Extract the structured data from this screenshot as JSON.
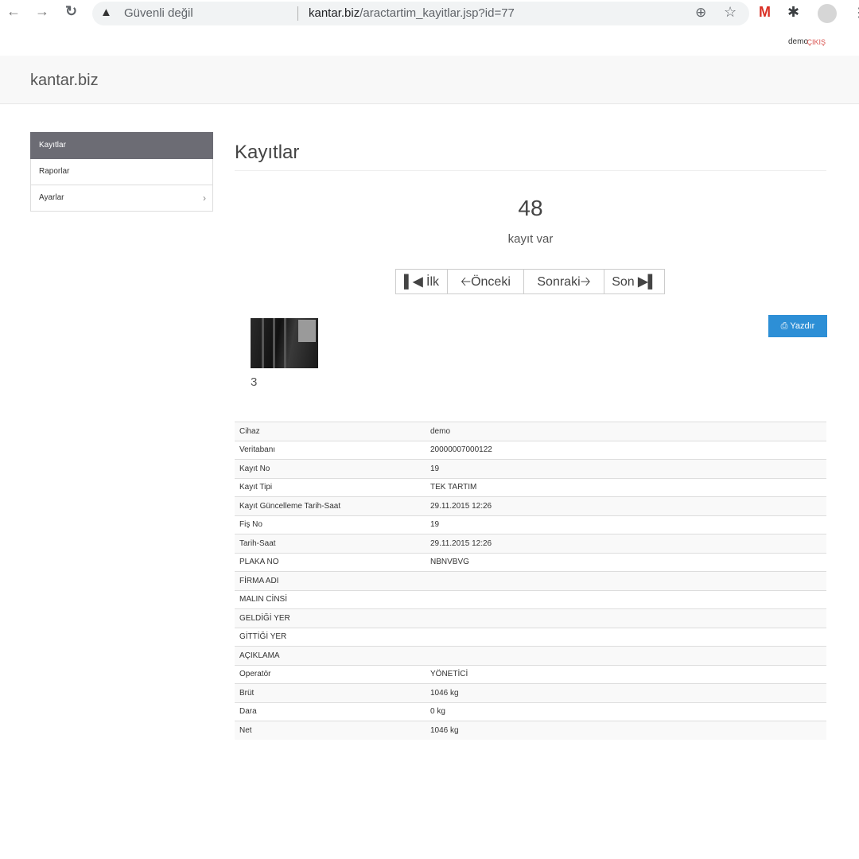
{
  "browser": {
    "security_label": "Güvenli değil",
    "url_host": "kantar.biz",
    "url_path": "/aractartim_kayitlar.jsp?id=77"
  },
  "topbar": {
    "user": "demo",
    "logout": "ÇIKIŞ"
  },
  "brand": "kantar.biz",
  "sidebar": {
    "items": [
      {
        "label": "Kayıtlar",
        "active": true
      },
      {
        "label": "Raporlar"
      },
      {
        "label": "Ayarlar"
      }
    ]
  },
  "main": {
    "title": "Kayıtlar",
    "count": "48",
    "count_label": "kayıt var",
    "pager": {
      "first": "İlk",
      "prev": "Önceki",
      "next": "Sonraki",
      "last": "Son"
    },
    "print_label": "Yazdır",
    "image_number": "3"
  },
  "record": [
    {
      "key": "Cihaz",
      "value": "demo"
    },
    {
      "key": "Veritabanı",
      "value": "20000007000122"
    },
    {
      "key": "Kayıt No",
      "value": "19"
    },
    {
      "key": "Kayıt Tipi",
      "value": "TEK TARTIM"
    },
    {
      "key": "Kayıt Güncelleme Tarih-Saat",
      "value": "29.11.2015 12:26"
    },
    {
      "key": "Fiş No",
      "value": "19"
    },
    {
      "key": "Tarih-Saat",
      "value": "29.11.2015 12:26"
    },
    {
      "key": "PLAKA NO",
      "value": "NBNVBVG"
    },
    {
      "key": "FİRMA ADI",
      "value": ""
    },
    {
      "key": "MALIN CİNSİ",
      "value": ""
    },
    {
      "key": "GELDİĞİ YER",
      "value": ""
    },
    {
      "key": "GİTTİĞİ YER",
      "value": ""
    },
    {
      "key": "AÇIKLAMA",
      "value": ""
    },
    {
      "key": "Operatör",
      "value": "YÖNETİCİ"
    },
    {
      "key": "Brüt",
      "value": "1046 kg"
    },
    {
      "key": "Dara",
      "value": "0 kg"
    },
    {
      "key": "Net",
      "value": "1046 kg"
    }
  ],
  "icons": {
    "back": "arrow-left-icon",
    "forward": "arrow-right-icon",
    "reload": "reload-icon",
    "warning": "warning-icon",
    "zoom": "zoom-icon",
    "bookmark": "star-icon",
    "gmail": "gmail-icon",
    "extensions": "puzzle-icon",
    "profile": "avatar",
    "menu": "kebab-menu-icon",
    "first": "step-backward-icon",
    "prev": "arrow-left-icon",
    "next": "arrow-right-icon",
    "last": "step-forward-icon",
    "print": "print-icon"
  }
}
